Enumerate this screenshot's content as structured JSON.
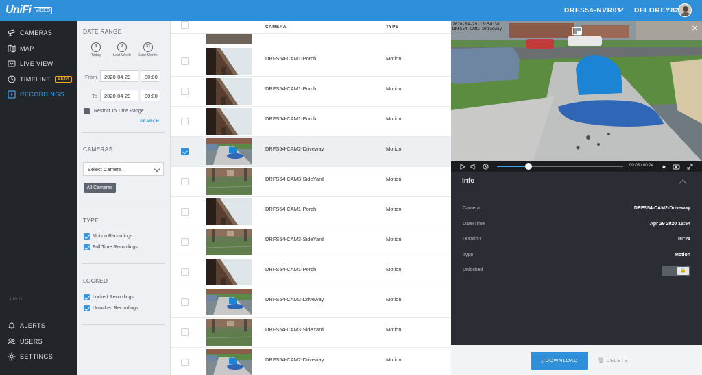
{
  "app": {
    "logo_text": "UniFi",
    "logo_tag": "VIDEO",
    "nvr_name": "DRFS54-NVR01",
    "user_name": "DFLOREY82",
    "version": "3.10.11"
  },
  "nav": {
    "items": [
      {
        "label": "CAMERAS",
        "icon": "camera-icon"
      },
      {
        "label": "MAP",
        "icon": "map-icon"
      },
      {
        "label": "LIVE VIEW",
        "icon": "live-view-icon"
      },
      {
        "label": "TIMELINE",
        "icon": "clock-icon",
        "badge": "BETA"
      },
      {
        "label": "RECORDINGS",
        "icon": "recordings-icon",
        "active": true
      }
    ],
    "bottom": [
      {
        "label": "ALERTS",
        "icon": "bell-icon"
      },
      {
        "label": "USERS",
        "icon": "users-icon"
      },
      {
        "label": "SETTINGS",
        "icon": "gear-icon"
      }
    ]
  },
  "filters": {
    "date_range_title": "DATE RANGE",
    "quick": [
      {
        "num": "1",
        "label": "Today"
      },
      {
        "num": "7",
        "label": "Last Week"
      },
      {
        "num": "31",
        "label": "Last Month"
      }
    ],
    "from_label": "From",
    "from_date": "2020-04-29",
    "from_time": "00:00",
    "to_label": "To",
    "to_date": "2020-04-29",
    "to_time": "00:00",
    "restrict_label": "Restrict To Time Range",
    "restrict_checked": false,
    "search_label": "SEARCH",
    "cameras_title": "CAMERAS",
    "select_camera": "Select Camera",
    "all_cameras": "All Cameras",
    "type_title": "TYPE",
    "motion_label": "Motion Recordings",
    "fulltime_label": "Full Time Recordings",
    "locked_title": "LOCKED",
    "locked_label": "Locked Recordings",
    "unlocked_label": "Unlocked Recordings"
  },
  "list": {
    "headers": {
      "camera": "CAMERA",
      "type": "TYPE"
    },
    "rows": [
      {
        "camera": "DRFS54-CAM1-Porch",
        "type": "Motion",
        "thumb": "porch",
        "selected": false
      },
      {
        "camera": "DRFS54-CAM1-Porch",
        "type": "Motion",
        "thumb": "porch",
        "selected": false
      },
      {
        "camera": "DRFS54-CAM1-Porch",
        "type": "Motion",
        "thumb": "porch",
        "selected": false
      },
      {
        "camera": "DRFS54-CAM2-Driveway",
        "type": "Motion",
        "thumb": "driveway",
        "selected": true
      },
      {
        "camera": "DRFS54-CAM3-SideYard",
        "type": "Motion",
        "thumb": "sideyard",
        "selected": false
      },
      {
        "camera": "DRFS54-CAM1-Porch",
        "type": "Motion",
        "thumb": "porch",
        "selected": false
      },
      {
        "camera": "DRFS54-CAM3-SideYard",
        "type": "Motion",
        "thumb": "sideyard",
        "selected": false
      },
      {
        "camera": "DRFS54-CAM1-Porch",
        "type": "Motion",
        "thumb": "porch",
        "selected": false
      },
      {
        "camera": "DRFS54-CAM2-Driveway",
        "type": "Motion",
        "thumb": "driveway",
        "selected": false
      },
      {
        "camera": "DRFS54-CAM3-SideYard",
        "type": "Motion",
        "thumb": "sideyard",
        "selected": false
      },
      {
        "camera": "DRFS54-CAM2-Driveway",
        "type": "Motion",
        "thumb": "driveway",
        "selected": false
      }
    ]
  },
  "detail": {
    "overlay_date": "2020-04-29 15:54:38",
    "overlay_cam": "DRFS54-CAM2-Driveway",
    "time_display": "00:05 / 00:24",
    "progress": 0.25,
    "info_title": "Info",
    "fields": [
      {
        "key": "Camera",
        "value": "DRFS54-CAM2-Driveway"
      },
      {
        "key": "Date/Time",
        "value": "Apr 29 2020 15:54"
      },
      {
        "key": "Duration",
        "value": "00:24"
      },
      {
        "key": "Type",
        "value": "Motion"
      },
      {
        "key": "Unlocked",
        "value": ""
      }
    ],
    "download_label": "DOWNLOAD",
    "delete_label": "DELETE"
  }
}
